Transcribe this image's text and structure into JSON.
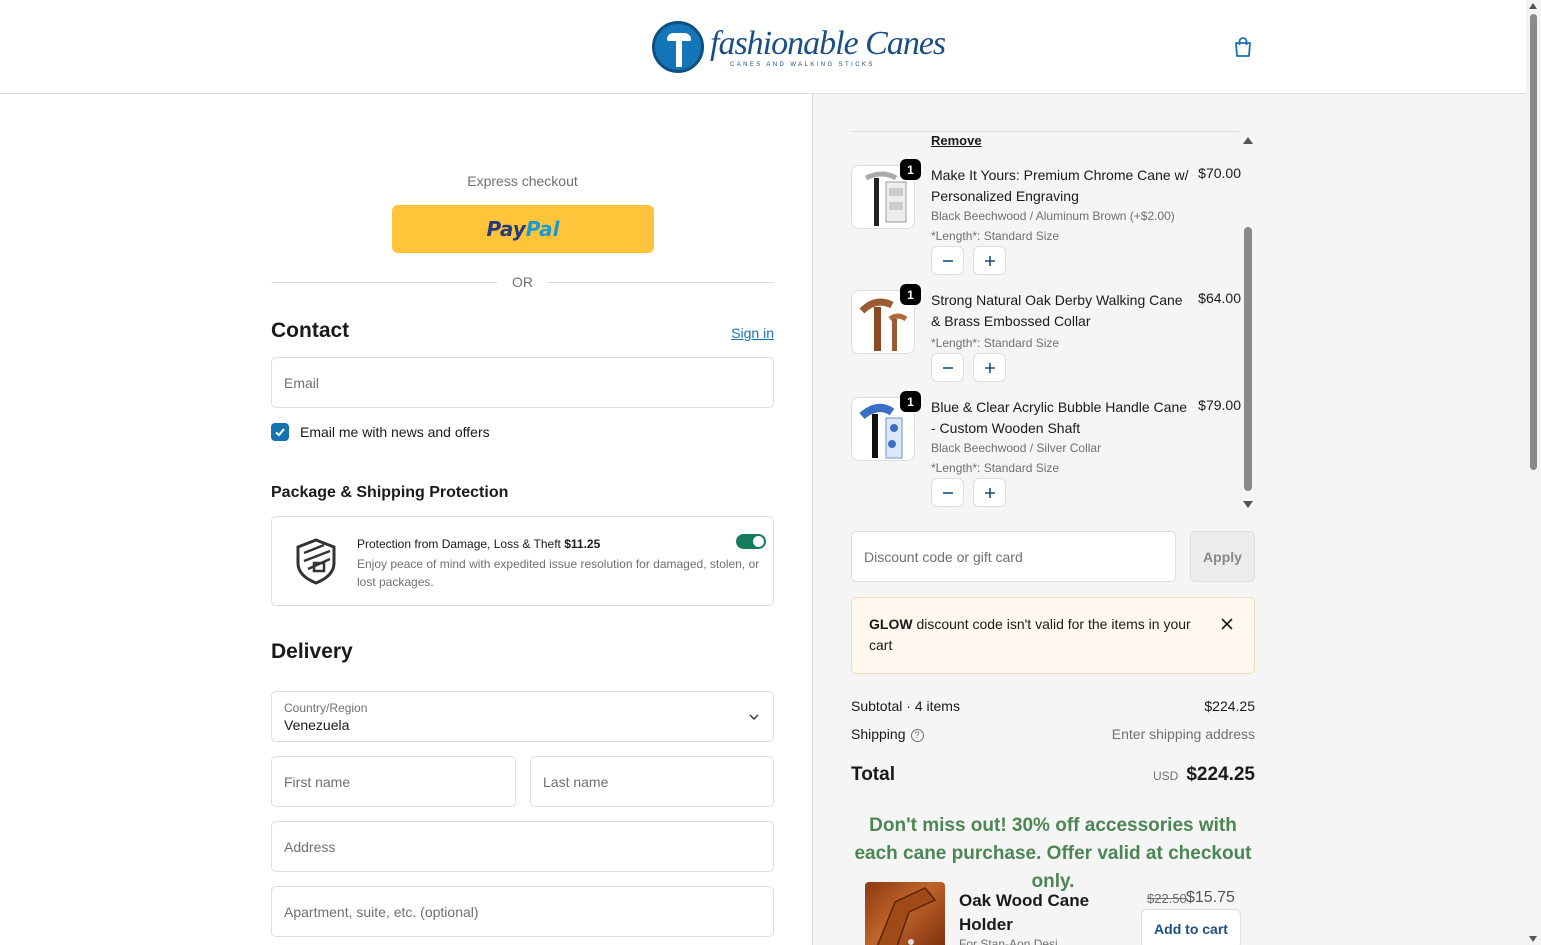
{
  "header": {
    "brand_name": "fashionable Canes",
    "brand_tagline": "CANES AND WALKING STICKS",
    "cart_icon": "shopping-bag-icon"
  },
  "express": {
    "label": "Express checkout",
    "paypal_pay": "Pay",
    "paypal_pal": "Pal",
    "or": "OR"
  },
  "contact": {
    "heading": "Contact",
    "sign_in": "Sign in",
    "email_placeholder": "Email",
    "newsletter_label": "Email me with news and offers",
    "newsletter_checked": true
  },
  "protection": {
    "heading": "Package & Shipping Protection",
    "title": "Protection from Damage, Loss & Theft",
    "price": "$11.25",
    "description": "Enjoy peace of mind with expedited issue resolution for damaged, stolen, or lost packages.",
    "enabled": true,
    "toggle_color": "#157b5d"
  },
  "delivery": {
    "heading": "Delivery",
    "country_label": "Country/Region",
    "country_value": "Venezuela",
    "first_name_placeholder": "First name",
    "last_name_placeholder": "Last name",
    "address_placeholder": "Address",
    "apartment_placeholder": "Apartment, suite, etc. (optional)"
  },
  "cart": {
    "remove_label": "Remove",
    "items": [
      {
        "name": "Make It Yours: Premium Chrome Cane w/ Personalized Engraving",
        "price": "$70.00",
        "quantity": "1",
        "variant": "Black Beechwood / Aluminum Brown (+$2.00)",
        "length": "*Length*: Standard Size"
      },
      {
        "name": "Strong Natural Oak Derby Walking Cane & Brass Embossed Collar",
        "price": "$64.00",
        "quantity": "1",
        "length": "*Length*: Standard Size"
      },
      {
        "name": "Blue & Clear Acrylic Bubble Handle Cane - Custom Wooden Shaft",
        "price": "$79.00",
        "quantity": "1",
        "variant": "Black Beechwood / Silver Collar",
        "length": "*Length*: Standard Size"
      }
    ]
  },
  "discount": {
    "placeholder": "Discount code or gift card",
    "apply_label": "Apply",
    "alert_code": "GLOW",
    "alert_text": "discount code isn't valid for the items in your cart"
  },
  "summary": {
    "subtotal_label": "Subtotal · 4 items",
    "subtotal_value": "$224.25",
    "shipping_label": "Shipping",
    "shipping_value": "Enter shipping address",
    "total_label": "Total",
    "currency": "USD",
    "total_value": "$224.25"
  },
  "upsell": {
    "promo_text": "Don't miss out! 30% off accessories with each cane purchase. Offer valid at checkout only.",
    "product_name": "Oak Wood Cane Holder",
    "product_sub": "For Stan-Aon Desi...",
    "old_price": "$22.50",
    "new_price": "$15.75",
    "add_label": "Add to cart"
  },
  "colors": {
    "accent": "#1773b0",
    "paypal_yellow": "#ffc439",
    "promo_green": "#4b8654",
    "alert_bg": "#fff8ef"
  }
}
